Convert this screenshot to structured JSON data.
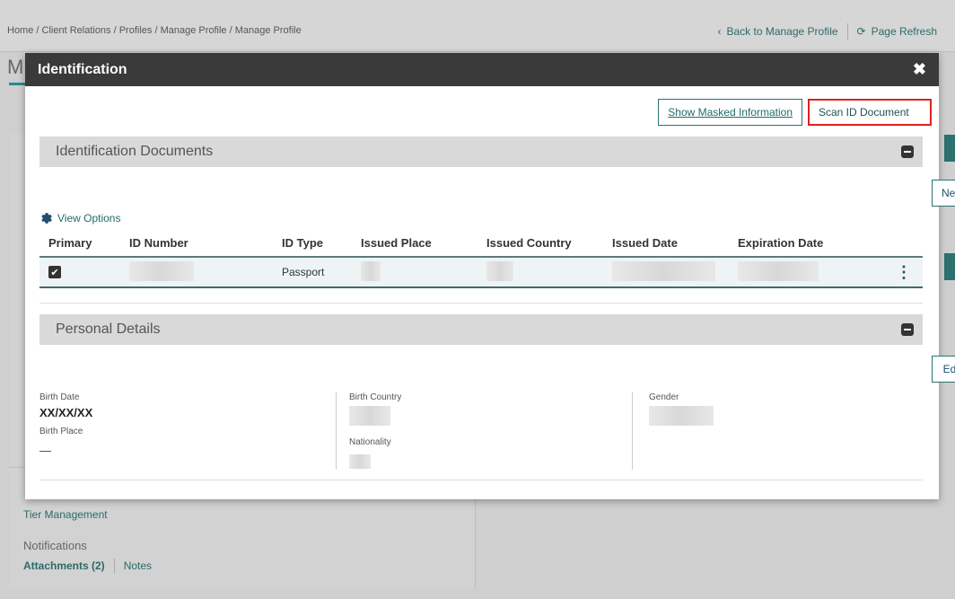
{
  "background": {
    "breadcrumb": "Home / Client Relations / Profiles / Manage Profile / Manage Profile",
    "back_link": "Back to Manage Profile",
    "refresh_link": "Page Refresh",
    "title_letter": "M",
    "tier_management": "Tier Management",
    "notifications": "Notifications",
    "attachments": "Attachments (2)",
    "notes": "Notes"
  },
  "modal": {
    "title": "Identification",
    "show_masked": "Show Masked Information",
    "scan_id": "Scan ID Document",
    "id_docs": {
      "title": "Identification Documents",
      "new_button": "New",
      "view_options": "View Options",
      "columns": [
        "Primary",
        "ID Number",
        "ID Type",
        "Issued Place",
        "Issued Country",
        "Issued Date",
        "Expiration Date"
      ],
      "rows": [
        {
          "primary": true,
          "id_type": "Passport"
        }
      ]
    },
    "personal": {
      "title": "Personal Details",
      "edit_button": "Edit",
      "birth_date_label": "Birth Date",
      "birth_date_value": "XX/XX/XX",
      "birth_place_label": "Birth Place",
      "birth_place_value": "—",
      "birth_country_label": "Birth Country",
      "nationality_label": "Nationality",
      "gender_label": "Gender"
    }
  },
  "colors": {
    "accent": "#2c7070",
    "highlight": "#e02020",
    "header": "#3a3a3a"
  }
}
